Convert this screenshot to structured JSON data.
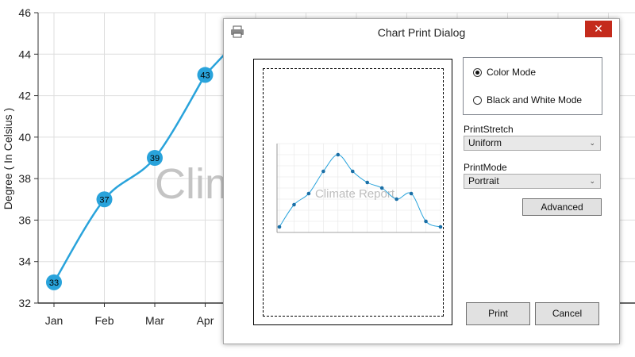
{
  "chart_data": {
    "type": "line",
    "categories": [
      "Jan",
      "Feb",
      "Mar",
      "Apr"
    ],
    "values": [
      33,
      37,
      39,
      43
    ],
    "ylabel": "Degree ( In Celsius )",
    "ylim": [
      32,
      46
    ],
    "yticks": [
      32,
      34,
      36,
      38,
      40,
      42,
      44,
      46
    ],
    "watermark": "Clim",
    "line_color": "#29a3db",
    "grid": true
  },
  "dialog": {
    "title": "Chart Print Dialog",
    "close_label": "✕",
    "color_mode_label": "Color Mode",
    "bw_mode_label": "Black and White Mode",
    "selected_mode": "Color Mode",
    "print_stretch_label": "PrintStretch",
    "print_stretch_value": "Uniform",
    "print_mode_label": "PrintMode",
    "print_mode_value": "Portrait",
    "advanced_label": "Advanced",
    "print_label": "Print",
    "cancel_label": "Cancel",
    "accent_color": "#c42b1c"
  },
  "preview_chart": {
    "watermark": "Climate Report",
    "values": [
      33,
      37,
      39,
      43,
      46,
      43,
      41,
      40,
      38,
      39,
      34,
      33
    ],
    "ylim": [
      32,
      48
    ],
    "line_color": "#29a3db"
  }
}
